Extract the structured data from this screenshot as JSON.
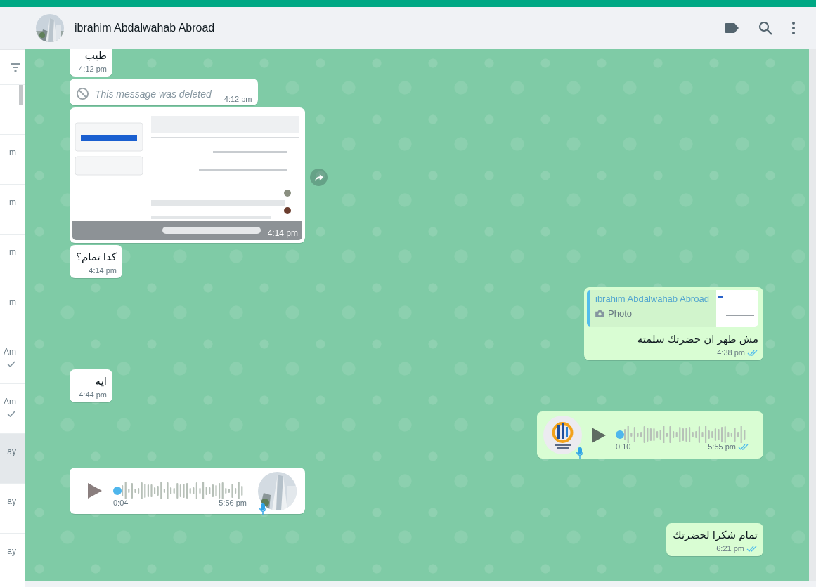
{
  "chat_header": {
    "name": "ibrahim Abdalwahab Abroad"
  },
  "sidebar": {
    "items": [
      {
        "time": "m",
        "ticked": false,
        "selected": false
      },
      {
        "time": "m",
        "ticked": false,
        "selected": false
      },
      {
        "time": "m",
        "ticked": false,
        "selected": false
      },
      {
        "time": "m",
        "ticked": false,
        "selected": false
      },
      {
        "time": "Am",
        "ticked": true,
        "selected": false
      },
      {
        "time": "Am",
        "ticked": true,
        "selected": false
      },
      {
        "time": "ay",
        "ticked": false,
        "selected": true
      },
      {
        "time": "ay",
        "ticked": false,
        "selected": false
      },
      {
        "time": "ay",
        "ticked": false,
        "selected": false
      }
    ]
  },
  "messages": [
    {
      "kind": "text",
      "outgoing": false,
      "text": "طيب",
      "time": "4:12 pm"
    },
    {
      "kind": "deleted",
      "outgoing": false,
      "text": "This message was deleted",
      "time": "4:12 pm"
    },
    {
      "outgoing": false,
      "time": "4:14 pm"
    },
    {
      "kind": "text",
      "outgoing": false,
      "text": "كدا تمام؟",
      "time": "4:14 pm"
    },
    {
      "kind": "reply",
      "outgoing": true,
      "quote": {
        "author": "ibrahim Abdalwahab Abroad",
        "label": "Photo"
      },
      "text": "مش ظهر ان حضرتك سلمته",
      "time": "4:38 pm",
      "read": true
    },
    {
      "kind": "text",
      "outgoing": false,
      "text": "ايه",
      "time": "4:44 pm"
    },
    {
      "kind": "voice",
      "outgoing": true,
      "duration": "0:10",
      "time": "5:55 pm",
      "read": true
    },
    {
      "kind": "voice",
      "outgoing": false,
      "duration": "0:04",
      "time": "5:56 pm"
    },
    {
      "kind": "text",
      "outgoing": true,
      "text": "تمام شكرا لحضرتك",
      "time": "6:21 pm",
      "read": true
    }
  ]
}
